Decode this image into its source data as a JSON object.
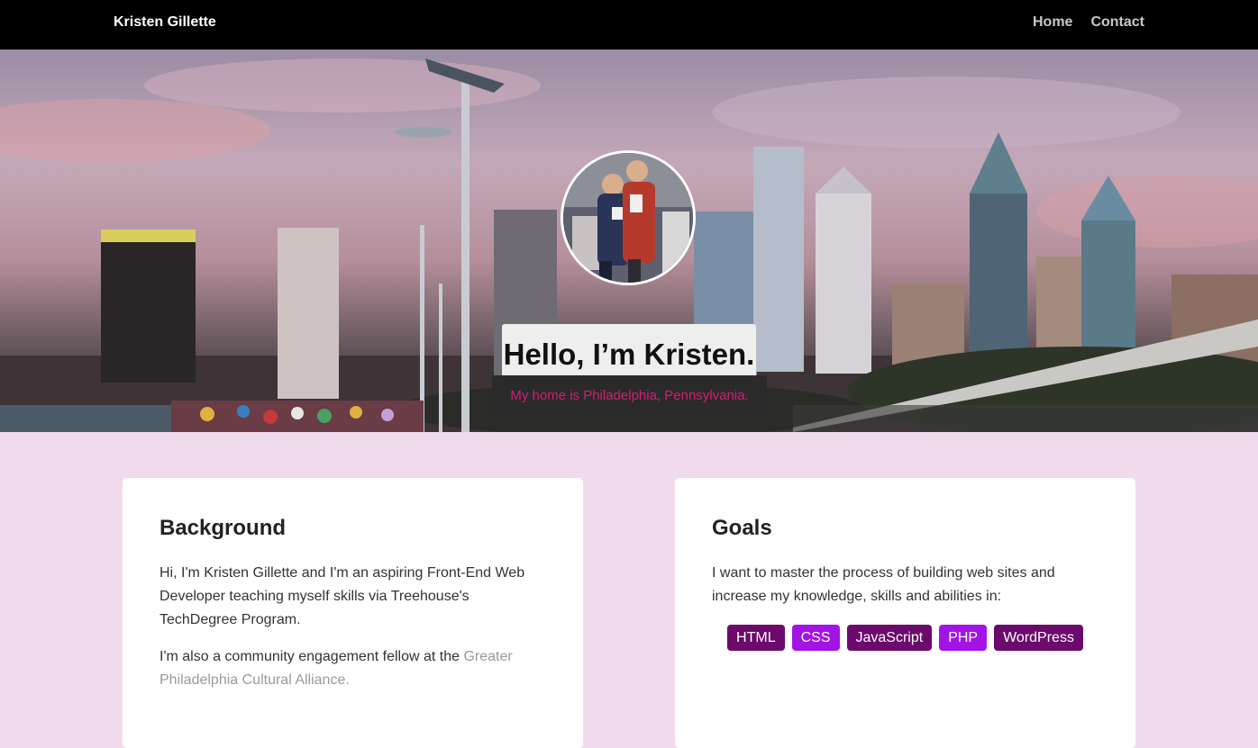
{
  "nav": {
    "brand": "Kristen Gillette",
    "links": [
      {
        "label": "Home"
      },
      {
        "label": "Contact"
      }
    ]
  },
  "hero": {
    "heading": "Hello, I’m Kristen.",
    "tagline": "My home is Philadelphia, Pennsylvania."
  },
  "background_card": {
    "title": "Background",
    "paragraph1": "Hi, I'm Kristen Gillette and I'm an aspiring Front-End Web Developer teaching myself skills via Treehouse's TechDegree Program.",
    "paragraph2_prefix": "I'm also a community engagement fellow at the ",
    "paragraph2_link": "Greater Philadelphia Cultural Alliance."
  },
  "goals_card": {
    "title": "Goals",
    "paragraph": "I want to master the process of building web sites and increase my knowledge, skills and abilities in:",
    "skills": [
      {
        "label": "HTML",
        "color": "#6c0a6c"
      },
      {
        "label": "CSS",
        "color": "#a313e6"
      },
      {
        "label": "JavaScript",
        "color": "#6c0a6c"
      },
      {
        "label": "PHP",
        "color": "#a313e6"
      },
      {
        "label": "WordPress",
        "color": "#6c0a6c"
      }
    ]
  },
  "colors": {
    "nav_bg": "#000000",
    "page_bg": "#f0dbec",
    "tagline_text": "#d21d73",
    "tag_dark": "#6c0a6c",
    "tag_bright": "#a313e6"
  }
}
